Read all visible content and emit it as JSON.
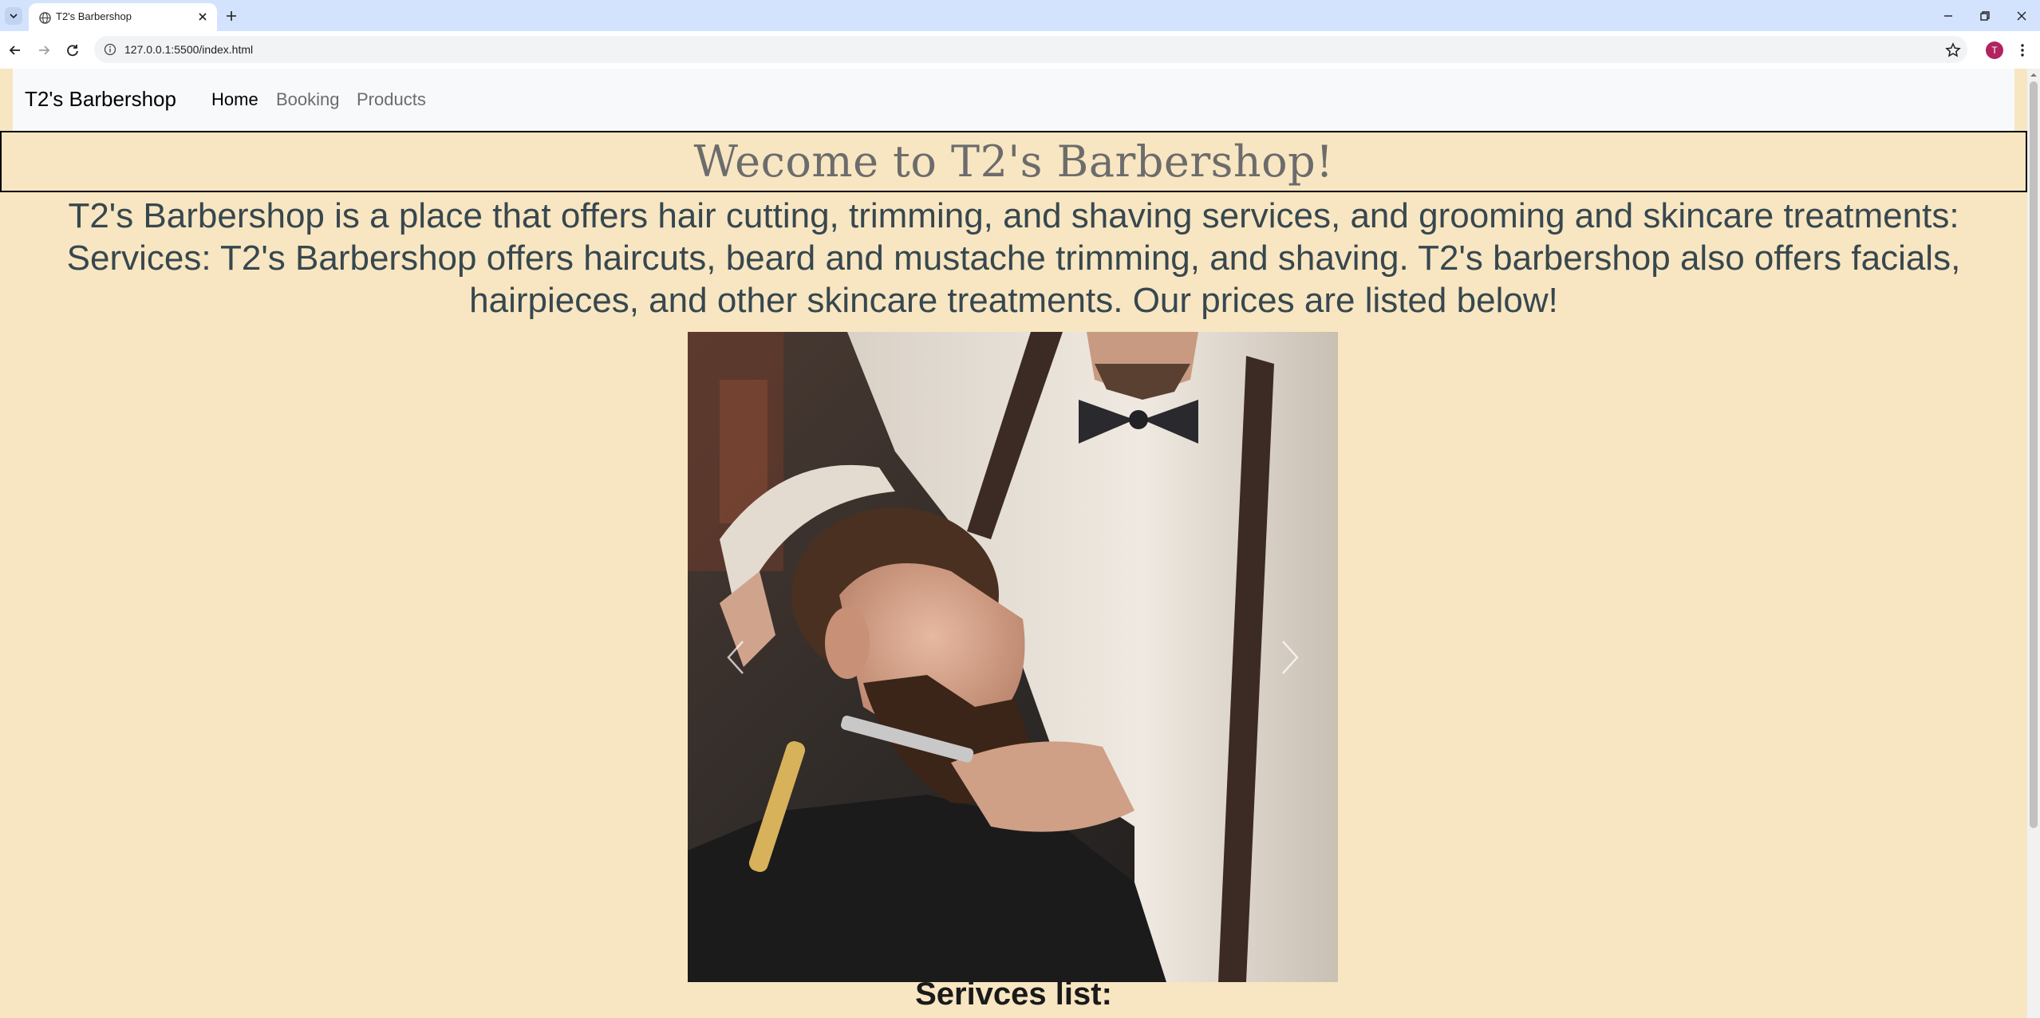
{
  "browser": {
    "tab_title": "T2's Barbershop",
    "url": "127.0.0.1:5500/index.html",
    "profile_initial": "T"
  },
  "site": {
    "brand": "T2's Barbershop",
    "nav": [
      {
        "label": "Home",
        "active": true
      },
      {
        "label": "Booking",
        "active": false
      },
      {
        "label": "Products",
        "active": false
      }
    ],
    "heading": "Wecome to T2's Barbershop!",
    "intro": "T2's Barbershop is a place that offers hair cutting, trimming, and shaving services, and grooming and skincare treatments: Services: T2's Barbershop offers haircuts, beard and mustache trimming, and shaving. T2's barbershop also offers facials, hairpieces, and other skincare treatments. Our prices are listed below!",
    "services_title": "Serivces list:"
  },
  "colors": {
    "page_bg": "#f7e6c1",
    "nav_bg": "#f8f9fa",
    "heading_text": "#6c6c6c",
    "intro_text": "#37474f",
    "tabstrip_bg": "#d3e3fd"
  },
  "icons": [
    "tab-list-icon",
    "globe-icon",
    "close-icon",
    "plus-icon",
    "minimize-icon",
    "restore-icon",
    "back-icon",
    "forward-icon",
    "reload-icon",
    "info-icon",
    "star-icon",
    "kebab-menu-icon",
    "chevron-left-icon",
    "chevron-right-icon"
  ]
}
